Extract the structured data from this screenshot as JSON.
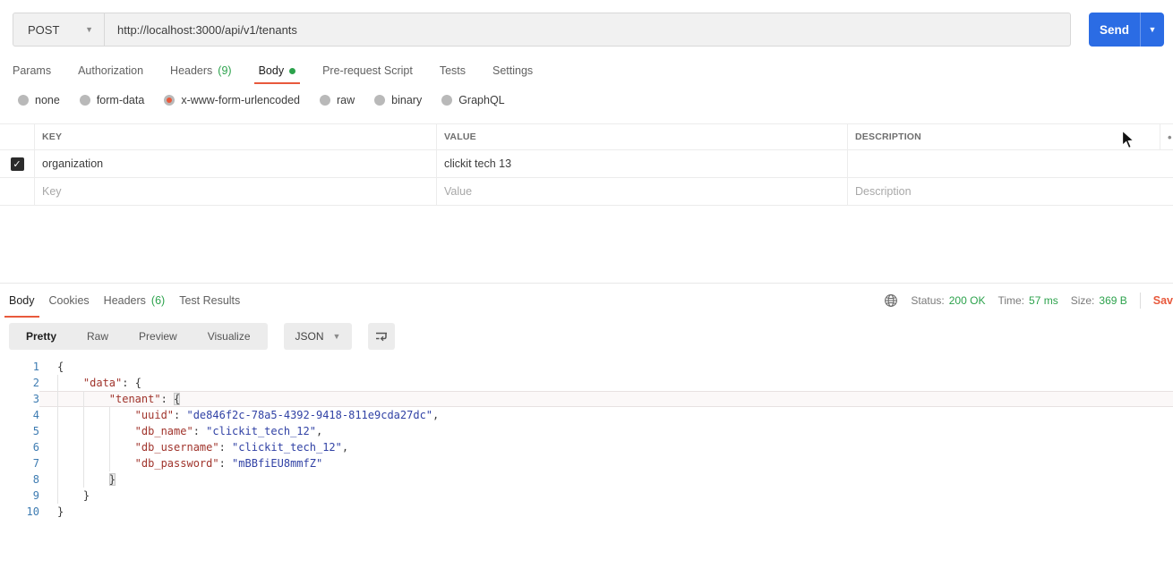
{
  "colors": {
    "accent_orange": "#e8593c",
    "success_green": "#2ca24c",
    "send_blue": "#2b6ce4",
    "json_key_red": "#a0342c",
    "json_string_blue": "#3142a5",
    "line_number_blue": "#3e7cb2"
  },
  "request": {
    "method": "POST",
    "url": "http://localhost:3000/api/v1/tenants",
    "send_label": "Send",
    "tabs": [
      {
        "label": "Params"
      },
      {
        "label": "Authorization"
      },
      {
        "label": "Headers",
        "count": "(9)"
      },
      {
        "label": "Body",
        "active": true,
        "dot": true
      },
      {
        "label": "Pre-request Script"
      },
      {
        "label": "Tests"
      },
      {
        "label": "Settings"
      }
    ],
    "body_modes": [
      {
        "label": "none"
      },
      {
        "label": "form-data"
      },
      {
        "label": "x-www-form-urlencoded",
        "selected": true
      },
      {
        "label": "raw"
      },
      {
        "label": "binary"
      },
      {
        "label": "GraphQL"
      }
    ],
    "table": {
      "headers": [
        "KEY",
        "VALUE",
        "DESCRIPTION"
      ],
      "header_menu_icon": "•",
      "rows": [
        {
          "checked": true,
          "check_glyph": "✓",
          "key": "organization",
          "value": "clickit tech 13",
          "description": ""
        }
      ],
      "placeholders": {
        "key": "Key",
        "value": "Value",
        "description": "Description"
      }
    }
  },
  "response": {
    "tabs": [
      {
        "label": "Body",
        "active": true
      },
      {
        "label": "Cookies"
      },
      {
        "label": "Headers",
        "count": "(6)"
      },
      {
        "label": "Test Results"
      }
    ],
    "meta": {
      "status_label": "Status:",
      "status_value": "200 OK",
      "time_label": "Time:",
      "time_value": "57 ms",
      "size_label": "Size:",
      "size_value": "369 B",
      "save_label": "Sav"
    },
    "view_tabs": [
      {
        "label": "Pretty",
        "active": true
      },
      {
        "label": "Raw"
      },
      {
        "label": "Preview"
      },
      {
        "label": "Visualize"
      }
    ],
    "format": "JSON",
    "code": {
      "lines": [
        {
          "n": 1,
          "indent": 0,
          "segs": [
            {
              "c": "pn",
              "t": "{"
            }
          ]
        },
        {
          "n": 2,
          "indent": 1,
          "segs": [
            {
              "c": "key",
              "t": "\"data\""
            },
            {
              "c": "pn",
              "t": ": {"
            }
          ]
        },
        {
          "n": 3,
          "indent": 2,
          "active": true,
          "segs": [
            {
              "c": "key",
              "t": "\"tenant\""
            },
            {
              "c": "pn",
              "t": ": "
            },
            {
              "c": "pn",
              "t": "{",
              "box": true
            }
          ]
        },
        {
          "n": 4,
          "indent": 3,
          "segs": [
            {
              "c": "key",
              "t": "\"uuid\""
            },
            {
              "c": "pn",
              "t": ": "
            },
            {
              "c": "str",
              "t": "\"de846f2c-78a5-4392-9418-811e9cda27dc\""
            },
            {
              "c": "pn",
              "t": ","
            }
          ]
        },
        {
          "n": 5,
          "indent": 3,
          "segs": [
            {
              "c": "key",
              "t": "\"db_name\""
            },
            {
              "c": "pn",
              "t": ": "
            },
            {
              "c": "str",
              "t": "\"clickit_tech_12\""
            },
            {
              "c": "pn",
              "t": ","
            }
          ]
        },
        {
          "n": 6,
          "indent": 3,
          "segs": [
            {
              "c": "key",
              "t": "\"db_username\""
            },
            {
              "c": "pn",
              "t": ": "
            },
            {
              "c": "str",
              "t": "\"clickit_tech_12\""
            },
            {
              "c": "pn",
              "t": ","
            }
          ]
        },
        {
          "n": 7,
          "indent": 3,
          "segs": [
            {
              "c": "key",
              "t": "\"db_password\""
            },
            {
              "c": "pn",
              "t": ": "
            },
            {
              "c": "str",
              "t": "\"mBBfiEU8mmfZ\""
            }
          ]
        },
        {
          "n": 8,
          "indent": 2,
          "segs": [
            {
              "c": "pn",
              "t": "}",
              "box": true
            }
          ]
        },
        {
          "n": 9,
          "indent": 1,
          "segs": [
            {
              "c": "pn",
              "t": "}"
            }
          ]
        },
        {
          "n": 10,
          "indent": 0,
          "segs": [
            {
              "c": "pn",
              "t": "}"
            }
          ]
        }
      ]
    }
  }
}
